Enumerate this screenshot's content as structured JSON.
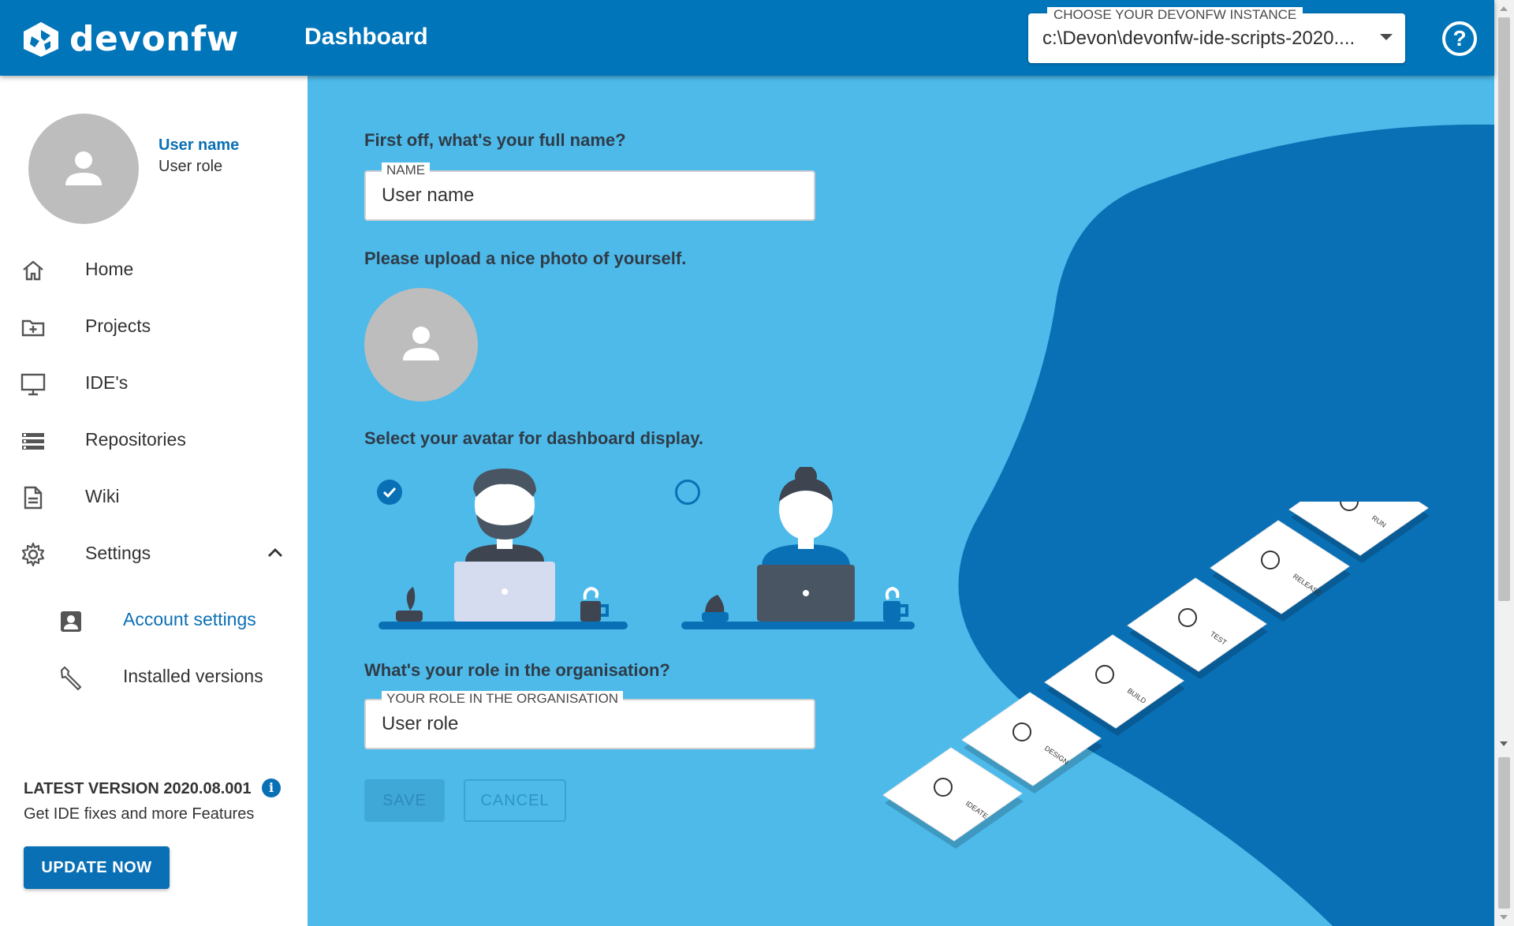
{
  "app": {
    "logo_text": "devonfw",
    "page_title": "Dashboard",
    "instance_label": "CHOOSE YOUR DEVONFW INSTANCE",
    "instance_value": "c:\\Devon\\devonfw-ide-scripts-2020....",
    "help_glyph": "?"
  },
  "colors": {
    "header": "#0075b9",
    "accent": "#0a70b5",
    "main_bg": "#4dbaea",
    "blob": "#0a70b5"
  },
  "sidebar": {
    "user_name": "User name",
    "user_role": "User role",
    "items": [
      {
        "label": "Home",
        "icon": "home-icon"
      },
      {
        "label": "Projects",
        "icon": "folder-plus-icon"
      },
      {
        "label": "IDE's",
        "icon": "monitor-icon"
      },
      {
        "label": "Repositories",
        "icon": "list-icon"
      },
      {
        "label": "Wiki",
        "icon": "document-icon"
      },
      {
        "label": "Settings",
        "icon": "gear-icon"
      }
    ],
    "subitems": [
      {
        "label": "Account settings",
        "icon": "account-box-icon",
        "active": true
      },
      {
        "label": "Installed versions",
        "icon": "wrench-icon",
        "active": false
      }
    ],
    "latest_version": "LATEST VERSION 2020.08.001",
    "latest_sub": "Get IDE fixes and more Features",
    "update_button": "UPDATE NOW"
  },
  "form": {
    "q_name": "First off, what's your full name?",
    "name_label": "NAME",
    "name_value": "User name",
    "q_photo": "Please upload a nice photo of yourself.",
    "q_avatar": "Select your avatar for dashboard display.",
    "avatars": [
      {
        "name": "male-avatar",
        "selected": true
      },
      {
        "name": "female-avatar",
        "selected": false
      }
    ],
    "q_role": "What's your role in the organisation?",
    "role_label": "YOUR ROLE IN THE ORGANISATION",
    "role_value": "User role",
    "save_button": "SAVE",
    "cancel_button": "CANCEL"
  },
  "workflow_tiles": [
    "IDEATE",
    "DESIGN",
    "BUILD",
    "TEST",
    "RELEASE",
    "RUN"
  ]
}
